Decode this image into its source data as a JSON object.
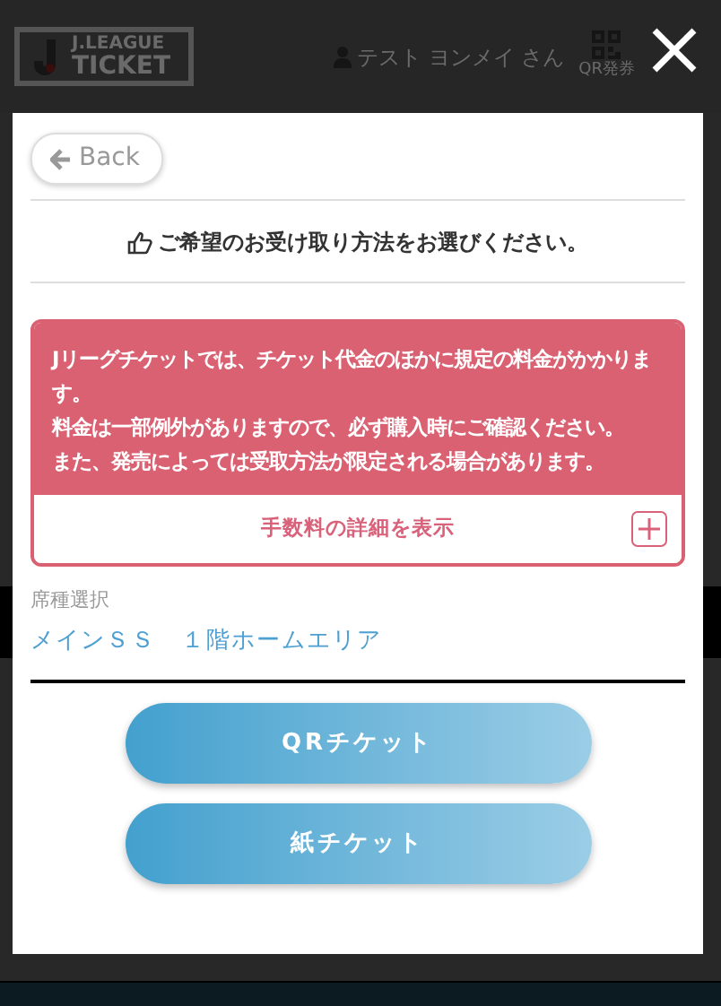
{
  "header": {
    "logo_lines": [
      "J.LEAGUE",
      "TICKET"
    ],
    "user_name": "テスト ヨンメイ さん",
    "qr_label": "QR発券"
  },
  "modal": {
    "back_label": "Back",
    "instruction": "ご希望のお受け取り方法をお選びください。",
    "notice": {
      "paragraphs": [
        "Jリーグチケットでは、チケット代金のほかに規定の料金がかかります。",
        "料金は一部例外がありますので、必ず購入時にご確認ください。",
        "また、発売によっては受取方法が限定される場合があります。"
      ],
      "toggle_label": "手数料の詳細を表示",
      "expanded": false
    },
    "seat": {
      "label": "席種選択",
      "value": "メインＳＳ　１階ホームエリア"
    },
    "buttons": [
      "QRチケット",
      "紙チケット"
    ]
  }
}
